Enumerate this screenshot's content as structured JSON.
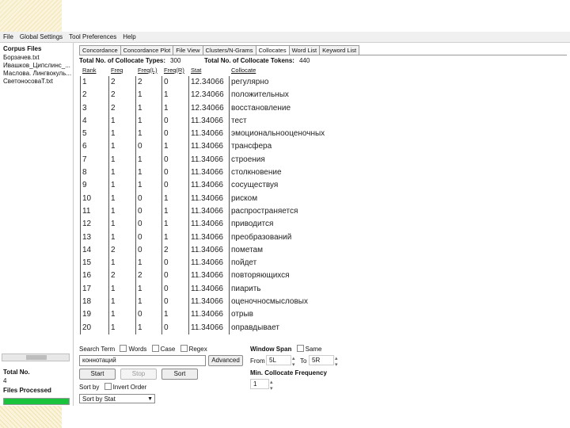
{
  "menu": [
    "File",
    "Global Settings",
    "Tool Preferences",
    "Help"
  ],
  "sidebar": {
    "title": "Corpus Files",
    "files": [
      "Борзачев.txt",
      "Ивашков_Ципслинс_...",
      "Маслова. Лингвокуль...",
      "СветоносоваТ.txt"
    ],
    "total_label": "Total No.",
    "total_value": "4",
    "files_processed_label": "Files Processed",
    "progress": 1.0,
    "progress_color": "#19c33b"
  },
  "tabs": [
    "Concordance",
    "Concordance Plot",
    "File View",
    "Clusters/N-Grams",
    "Collocates",
    "Word List",
    "Keyword List"
  ],
  "active_tab": "Collocates",
  "collocates": {
    "types_label": "Total No. of Collocate Types:",
    "types_value": "300",
    "tokens_label": "Total No. of Collocate Tokens:",
    "tokens_value": "440",
    "columns": [
      "Rank",
      "Freq",
      "Freq(L)",
      "Freq(R)",
      "Stat",
      "Collocate"
    ],
    "rows": [
      [
        "1",
        "2",
        "2",
        "0",
        "12.34066",
        "регулярно"
      ],
      [
        "2",
        "2",
        "1",
        "1",
        "12.34066",
        "положительных"
      ],
      [
        "3",
        "2",
        "1",
        "1",
        "12.34066",
        "восстановление"
      ],
      [
        "4",
        "1",
        "1",
        "0",
        "11.34066",
        "тест"
      ],
      [
        "5",
        "1",
        "1",
        "0",
        "11.34066",
        "эмоциональнооценочных"
      ],
      [
        "6",
        "1",
        "0",
        "1",
        "11.34066",
        "трансфера"
      ],
      [
        "7",
        "1",
        "1",
        "0",
        "11.34066",
        "строения"
      ],
      [
        "8",
        "1",
        "1",
        "0",
        "11.34066",
        "столкновение"
      ],
      [
        "9",
        "1",
        "1",
        "0",
        "11.34066",
        "сосуществуя"
      ],
      [
        "10",
        "1",
        "0",
        "1",
        "11.34066",
        "риском"
      ],
      [
        "11",
        "1",
        "0",
        "1",
        "11.34066",
        "распространяется"
      ],
      [
        "12",
        "1",
        "0",
        "1",
        "11.34066",
        "приводится"
      ],
      [
        "13",
        "1",
        "0",
        "1",
        "11.34066",
        "преобразований"
      ],
      [
        "14",
        "2",
        "0",
        "2",
        "11.34066",
        "пометам"
      ],
      [
        "15",
        "1",
        "1",
        "0",
        "11.34066",
        "пойдет"
      ],
      [
        "16",
        "2",
        "2",
        "0",
        "11.34066",
        "повторяющихся"
      ],
      [
        "17",
        "1",
        "1",
        "0",
        "11.34066",
        "пиарить"
      ],
      [
        "18",
        "1",
        "1",
        "0",
        "11.34066",
        "оценочносмысловых"
      ],
      [
        "19",
        "1",
        "0",
        "1",
        "11.34066",
        "отрыв"
      ],
      [
        "20",
        "1",
        "1",
        "0",
        "11.34066",
        "оправдывает"
      ]
    ]
  },
  "search": {
    "search_term_label": "Search Term",
    "words_label": "Words",
    "case_label": "Case",
    "regex_label": "Regex",
    "value": "коннотаций",
    "advanced_label": "Advanced",
    "start_label": "Start",
    "stop_label": "Stop",
    "sort_label": "Sort"
  },
  "window_span": {
    "label": "Window Span",
    "same_label": "Same",
    "from_label": "From",
    "from_value": "5L",
    "to_label": "To",
    "to_value": "5R"
  },
  "min_freq": {
    "label": "Min. Collocate Frequency",
    "value": "1"
  },
  "sort": {
    "label": "Sort by",
    "invert_label": "Invert Order",
    "selected": "Sort by Stat"
  }
}
